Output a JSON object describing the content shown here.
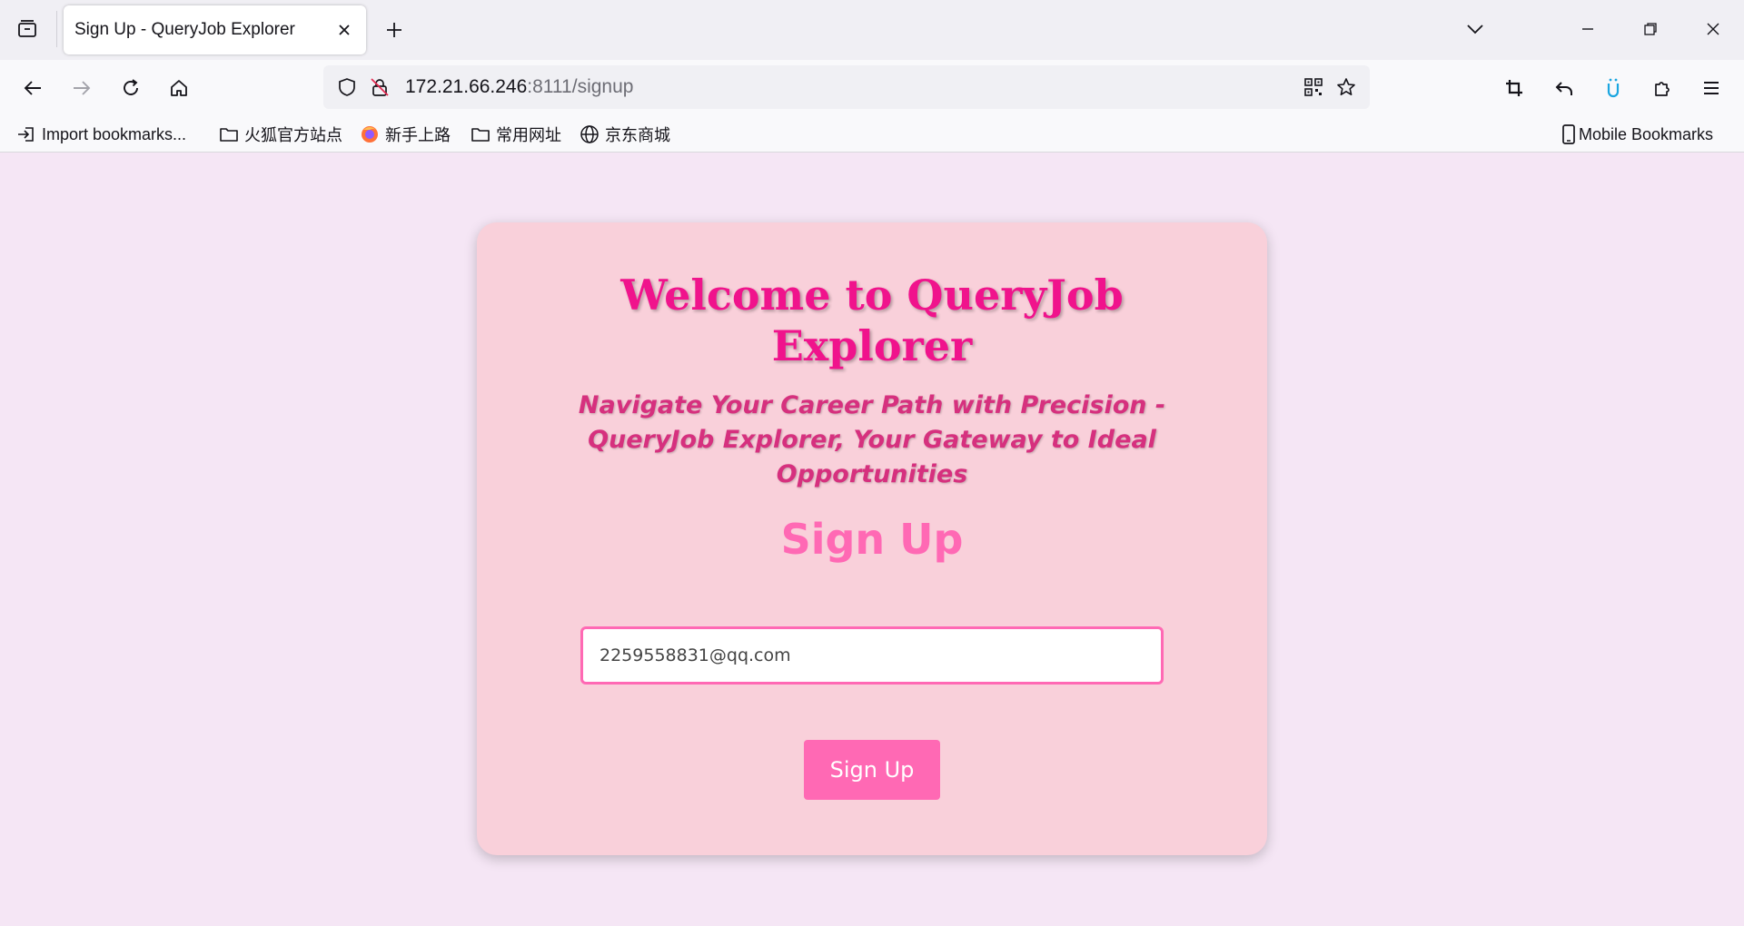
{
  "browser": {
    "tab": {
      "title": "Sign Up - QueryJob Explorer"
    },
    "url": {
      "host": "172.21.66.246",
      "rest": ":8111/signup"
    },
    "bookmarks": [
      {
        "label": "Import bookmarks...",
        "icon": "import-icon"
      },
      {
        "label": "火狐官方站点",
        "icon": "folder-icon"
      },
      {
        "label": "新手上路",
        "icon": "firefox-icon"
      },
      {
        "label": "常用网址",
        "icon": "folder-icon"
      },
      {
        "label": "京东商城",
        "icon": "globe-icon"
      }
    ],
    "mobile_bookmarks": "Mobile Bookmarks"
  },
  "page": {
    "welcome_title": "Welcome to QueryJob Explorer",
    "tagline": "Navigate Your Career Path with Precision - QueryJob Explorer, Your Gateway to Ideal Opportunities",
    "signup_heading": "Sign Up",
    "email_value": "2259558831@qq.com",
    "signup_button": "Sign Up"
  },
  "colors": {
    "page_bg": "#f5e6f5",
    "card_bg": "#f9d0da",
    "title": "#f0138c",
    "tagline": "#d6307e",
    "accent": "#ff69b4"
  }
}
